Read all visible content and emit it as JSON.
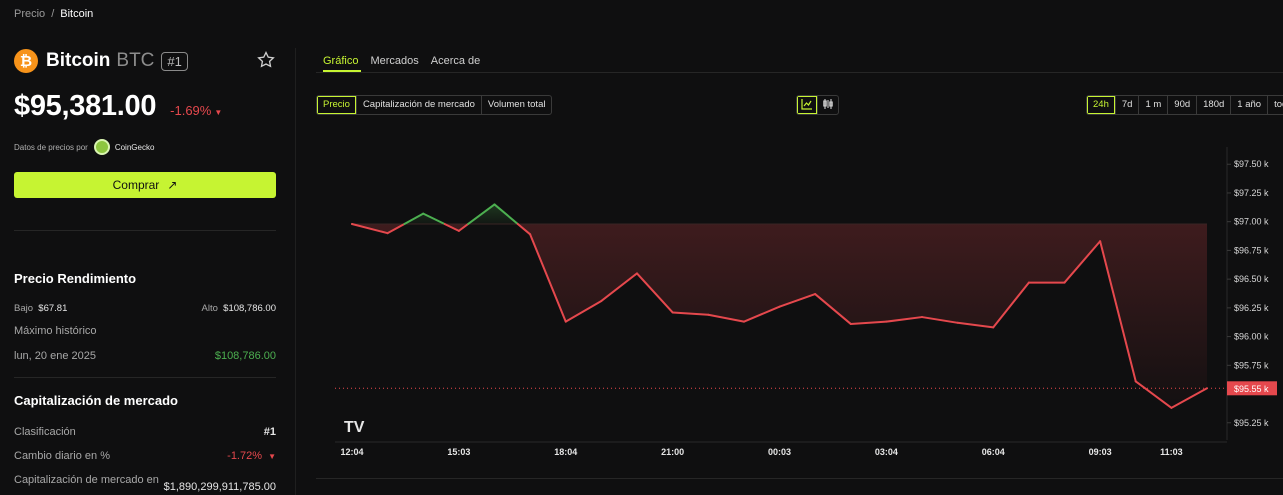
{
  "breadcrumb": {
    "root": "Precio",
    "separator": "/",
    "current": "Bitcoin"
  },
  "coin": {
    "logo_glyph": "₿",
    "name": "Bitcoin",
    "ticker": "BTC",
    "rank": "#1",
    "price": "$95,381.00",
    "change": "-1.69%",
    "change_arrow": "▼",
    "source_prefix": "Datos de precios por",
    "source_name": "CoinGecko",
    "buy_label": "Comprar",
    "buy_icon": "↗"
  },
  "performance": {
    "title": "Precio Rendimiento",
    "low_label": "Bajo",
    "low_value": "$67.81",
    "high_label": "Alto",
    "high_value": "$108,786.00",
    "ath_label": "Máximo histórico",
    "ath_date": "lun, 20 ene 2025",
    "ath_value": "$108,786.00"
  },
  "market_cap": {
    "title": "Capitalización de mercado",
    "rank_label": "Clasificación",
    "rank_value": "#1",
    "daily_label": "Cambio diario en %",
    "daily_value": "-1.72%",
    "daily_arrow": "▼",
    "cap_label": "Capitalización de mercado en",
    "cap_value": "$1,890,299,911,785.00"
  },
  "tabs": [
    "Gráfico",
    "Mercados",
    "Acerca de"
  ],
  "metric_toggle": [
    "Precio",
    "Capitalización de mercado",
    "Volumen total"
  ],
  "chart_style_icons": [
    "line-chart-icon",
    "candlestick-icon"
  ],
  "ranges": [
    "24h",
    "7d",
    "1 m",
    "90d",
    "180d",
    "1 año",
    "todo"
  ],
  "watermark": "TV",
  "colors": {
    "accent": "#c6f432",
    "up": "#4caf50",
    "down": "#e5484d",
    "background": "#0f0f10"
  },
  "chart_data": {
    "type": "line",
    "x": [
      "12:04",
      "13:00",
      "14:00",
      "15:03",
      "16:00",
      "17:00",
      "18:04",
      "19:00",
      "20:00",
      "21:00",
      "22:00",
      "23:00",
      "00:03",
      "01:00",
      "02:00",
      "03:04",
      "04:00",
      "05:00",
      "06:04",
      "07:00",
      "08:00",
      "09:03",
      "10:00",
      "11:03",
      "12:00"
    ],
    "y": [
      96.98,
      96.9,
      97.07,
      96.92,
      97.15,
      96.89,
      96.13,
      96.31,
      96.55,
      96.21,
      96.19,
      96.13,
      96.26,
      96.37,
      96.11,
      96.13,
      96.17,
      96.12,
      96.08,
      96.47,
      96.47,
      96.83,
      95.61,
      95.38,
      95.55
    ],
    "y_unit": "k",
    "ylim": [
      95.1,
      97.65
    ],
    "yticks": [
      "$97.50 k",
      "$97.25 k",
      "$97.00 k",
      "$96.75 k",
      "$96.50 k",
      "$96.25 k",
      "$96.00 k",
      "$95.75 k",
      "$95.55 k",
      "$95.25 k"
    ],
    "xticks": [
      "12:04",
      "15:03",
      "18:04",
      "21:00",
      "00:03",
      "03:04",
      "06:04",
      "09:03",
      "11:03"
    ],
    "baseline": 96.98,
    "last_price": 95.55,
    "last_price_label": "$95.55 k",
    "grid": false
  }
}
